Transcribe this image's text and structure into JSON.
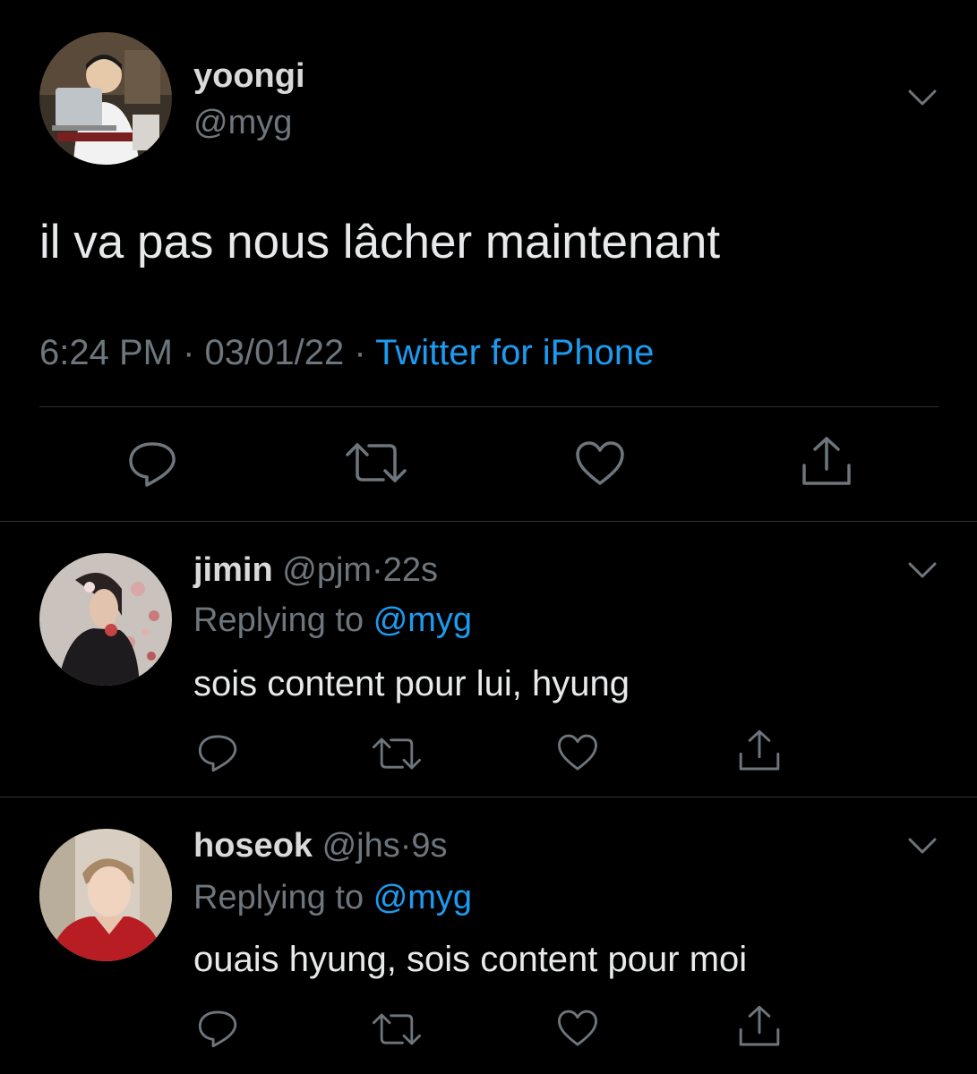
{
  "main_tweet": {
    "display_name": "yoongi",
    "handle": "@myg",
    "text": "il va pas nous lâcher maintenant",
    "time": "6:24 PM",
    "sep1": "·",
    "date": "03/01/22",
    "sep2": "·",
    "source": "Twitter for iPhone"
  },
  "replies": [
    {
      "display_name": "jimin",
      "handle": "@pjm",
      "sep": "·",
      "age": "22s",
      "replying_prefix": "Replying to",
      "replying_handle": "@myg",
      "text": "sois content pour lui, hyung"
    },
    {
      "display_name": "hoseok",
      "handle": "@jhs",
      "sep": "·",
      "age": "9s",
      "replying_prefix": "Replying to",
      "replying_handle": "@myg",
      "text": "ouais hyung, sois content pour moi"
    }
  ],
  "icons": {
    "reply": "reply-icon",
    "retweet": "retweet-icon",
    "like": "heart-icon",
    "share": "share-icon",
    "menu": "chevron-down-icon"
  },
  "colors": {
    "background": "#000000",
    "text": "#d9d9d9",
    "muted": "#6e767d",
    "link": "#1d9bf0",
    "divider": "#2f3336"
  }
}
